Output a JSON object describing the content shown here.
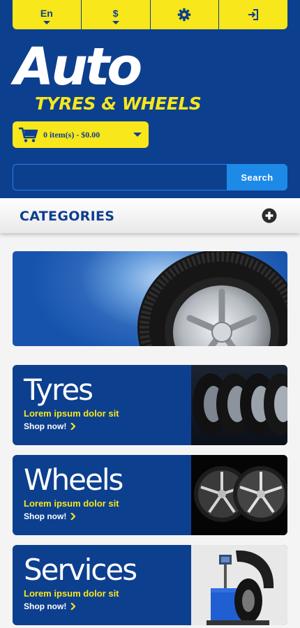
{
  "colors": {
    "primary": "#0d3f8f",
    "accent": "#f7e71b",
    "search_button": "#1e8ae8"
  },
  "topbar": {
    "language": {
      "label": "En",
      "icon": "chevron-down-icon"
    },
    "currency": {
      "label": "$",
      "icon": "chevron-down-icon"
    },
    "settings": {
      "icon": "gear-icon"
    },
    "login": {
      "icon": "sign-in-icon"
    }
  },
  "logo": {
    "main": "Auto",
    "sub": "TYRES & WHEELS"
  },
  "cart": {
    "summary": "0 item(s) - $0.00",
    "icon": "cart-icon"
  },
  "search": {
    "placeholder": "",
    "button_label": "Search"
  },
  "categories": {
    "label": "CATEGORIES",
    "icon": "plus-circle-icon"
  },
  "hero": {
    "image": "tyre-banner-image"
  },
  "promos": [
    {
      "title": "Tyres",
      "subtitle": "Lorem ipsum dolor sit",
      "link": "Shop now!",
      "image": "tyres-image"
    },
    {
      "title": "Wheels",
      "subtitle": "Lorem ipsum dolor sit",
      "link": "Shop now!",
      "image": "wheels-image"
    },
    {
      "title": "Services",
      "subtitle": "Lorem ipsum dolor sit",
      "link": "Shop now!",
      "image": "tire-changer-image"
    }
  ]
}
